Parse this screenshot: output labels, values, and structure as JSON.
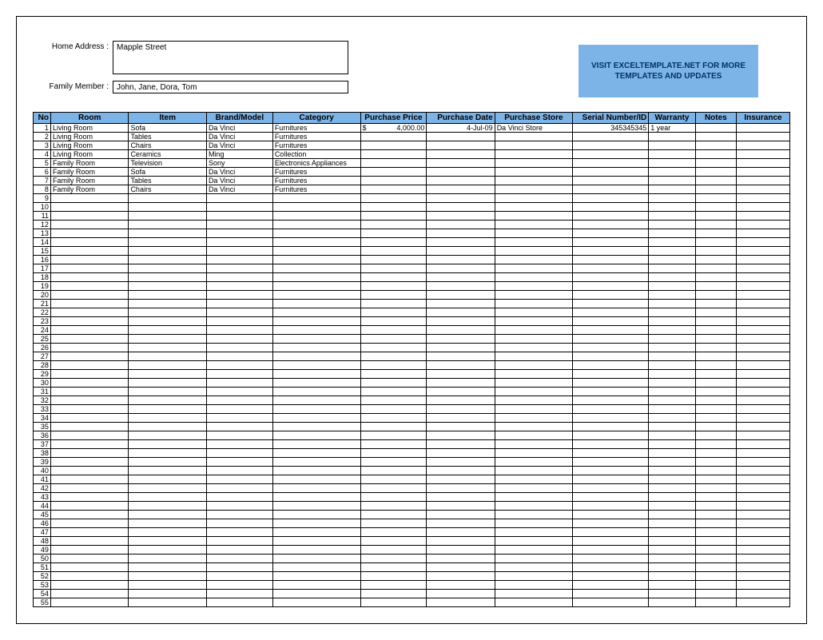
{
  "header": {
    "address_label": "Home Address :",
    "address_value": "Mapple Street",
    "member_label": "Family Member :",
    "member_value": "John, Jane, Dora, Tom",
    "banner_line1": "VISIT EXCELTEMPLATE.NET FOR MORE",
    "banner_line2": "TEMPLATES AND UPDATES"
  },
  "columns": {
    "no": "No",
    "room": "Room",
    "item": "Item",
    "brand": "Brand/Model",
    "category": "Category",
    "price": "Purchase Price",
    "date": "Purchase Date",
    "store": "Purchase Store",
    "serial": "Serial Number/ID",
    "warranty": "Warranty",
    "notes": "Notes",
    "insurance": "Insurance"
  },
  "rows": [
    {
      "no": "1",
      "room": "Living Room",
      "item": "Sofa",
      "brand": "Da Vinci",
      "category": "Furnitures",
      "price_currency": "$",
      "price_value": "4,000.00",
      "date": "4-Jul-09",
      "store": "Da Vinci Store",
      "serial": "345345345",
      "warranty": "1 year",
      "notes": "",
      "insurance": ""
    },
    {
      "no": "2",
      "room": "Living Room",
      "item": "Tables",
      "brand": "Da Vinci",
      "category": "Furnitures",
      "price_currency": "",
      "price_value": "",
      "date": "",
      "store": "",
      "serial": "",
      "warranty": "",
      "notes": "",
      "insurance": ""
    },
    {
      "no": "3",
      "room": "Living Room",
      "item": "Chairs",
      "brand": "Da Vinci",
      "category": "Furnitures",
      "price_currency": "",
      "price_value": "",
      "date": "",
      "store": "",
      "serial": "",
      "warranty": "",
      "notes": "",
      "insurance": ""
    },
    {
      "no": "4",
      "room": "Living Room",
      "item": "Ceramics",
      "brand": "Ming",
      "category": "Collection",
      "price_currency": "",
      "price_value": "",
      "date": "",
      "store": "",
      "serial": "",
      "warranty": "",
      "notes": "",
      "insurance": ""
    },
    {
      "no": "5",
      "room": "Family Room",
      "item": "Television",
      "brand": "Sony",
      "category": "Electronics Appliances",
      "price_currency": "",
      "price_value": "",
      "date": "",
      "store": "",
      "serial": "",
      "warranty": "",
      "notes": "",
      "insurance": ""
    },
    {
      "no": "6",
      "room": "Family Room",
      "item": "Sofa",
      "brand": "Da Vinci",
      "category": "Furnitures",
      "price_currency": "",
      "price_value": "",
      "date": "",
      "store": "",
      "serial": "",
      "warranty": "",
      "notes": "",
      "insurance": ""
    },
    {
      "no": "7",
      "room": "Family Room",
      "item": "Tables",
      "brand": "Da Vinci",
      "category": "Furnitures",
      "price_currency": "",
      "price_value": "",
      "date": "",
      "store": "",
      "serial": "",
      "warranty": "",
      "notes": "",
      "insurance": ""
    },
    {
      "no": "8",
      "room": "Family Room",
      "item": "Chairs",
      "brand": "Da Vinci",
      "category": "Furnitures",
      "price_currency": "",
      "price_value": "",
      "date": "",
      "store": "",
      "serial": "",
      "warranty": "",
      "notes": "",
      "insurance": ""
    },
    {
      "no": "9"
    },
    {
      "no": "10"
    },
    {
      "no": "11"
    },
    {
      "no": "12"
    },
    {
      "no": "13"
    },
    {
      "no": "14"
    },
    {
      "no": "15"
    },
    {
      "no": "16"
    },
    {
      "no": "17"
    },
    {
      "no": "18"
    },
    {
      "no": "19"
    },
    {
      "no": "20"
    },
    {
      "no": "21"
    },
    {
      "no": "22"
    },
    {
      "no": "23"
    },
    {
      "no": "24"
    },
    {
      "no": "25"
    },
    {
      "no": "26"
    },
    {
      "no": "27"
    },
    {
      "no": "28"
    },
    {
      "no": "29"
    },
    {
      "no": "30"
    },
    {
      "no": "31"
    },
    {
      "no": "32"
    },
    {
      "no": "33"
    },
    {
      "no": "34"
    },
    {
      "no": "35"
    },
    {
      "no": "36"
    },
    {
      "no": "37"
    },
    {
      "no": "38"
    },
    {
      "no": "39"
    },
    {
      "no": "40"
    },
    {
      "no": "41"
    },
    {
      "no": "42"
    },
    {
      "no": "43"
    },
    {
      "no": "44"
    },
    {
      "no": "45"
    },
    {
      "no": "46"
    },
    {
      "no": "47"
    },
    {
      "no": "48"
    },
    {
      "no": "49"
    },
    {
      "no": "50"
    },
    {
      "no": "51"
    },
    {
      "no": "52"
    },
    {
      "no": "53"
    },
    {
      "no": "54"
    },
    {
      "no": "55"
    }
  ]
}
